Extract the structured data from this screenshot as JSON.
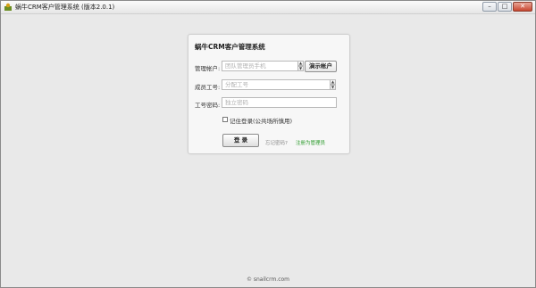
{
  "window": {
    "title": "蜗牛CRM客户管理系统 (版本2.0.1)",
    "controls": {
      "minimize": "–",
      "maximize": "□",
      "close": "✕"
    },
    "icon": "app-icon"
  },
  "login": {
    "title": "蜗牛CRM客户管理系统",
    "account_label": "管理帐户:",
    "account_placeholder": "团队管理员手机",
    "demo_button": "演示帐户",
    "member_label": "成员工号:",
    "member_placeholder": "分配工号",
    "password_label": "工号密码:",
    "password_placeholder": "独立密码",
    "remember_label": "记住登录(公共场所慎用)",
    "remember_checked": false,
    "login_button": "登 录",
    "forgot_link": "忘记密码?",
    "register_link": "注册为管理员"
  },
  "footer": {
    "copyright": "© snailcrm.com"
  },
  "colors": {
    "background": "#e9e9e9",
    "register_link": "#2a9a2a"
  }
}
